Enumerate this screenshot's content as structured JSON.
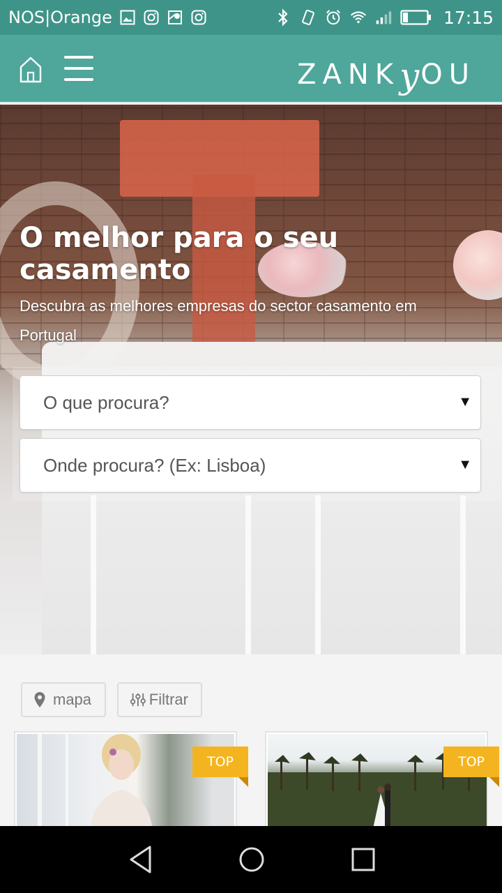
{
  "status_bar": {
    "carrier": "NOS|Orange",
    "time": "17:15",
    "left_icons": [
      "gallery-icon",
      "instagram-icon",
      "maps-icon",
      "instagram-icon"
    ],
    "right_icons": [
      "bluetooth-icon",
      "vibrate-icon",
      "alarm-icon",
      "wifi-icon",
      "signal-icon",
      "battery-icon"
    ]
  },
  "header": {
    "brand_main": "ZANK",
    "brand_y": "y",
    "brand_end": "OU",
    "accent_color": "#4fa69b"
  },
  "hero": {
    "title": "O melhor para o seu casamento",
    "subtitle": "Descubra as melhores empresas do sector casamento em Portugal"
  },
  "search": {
    "what_placeholder": "O que procura?",
    "where_placeholder": "Onde procura? (Ex: Lisboa)"
  },
  "filters": {
    "map_label": "mapa",
    "filter_label": "Filtrar"
  },
  "cards": [
    {
      "badge": "TOP"
    },
    {
      "badge": "TOP"
    }
  ],
  "badge_color": "#f4b41f"
}
